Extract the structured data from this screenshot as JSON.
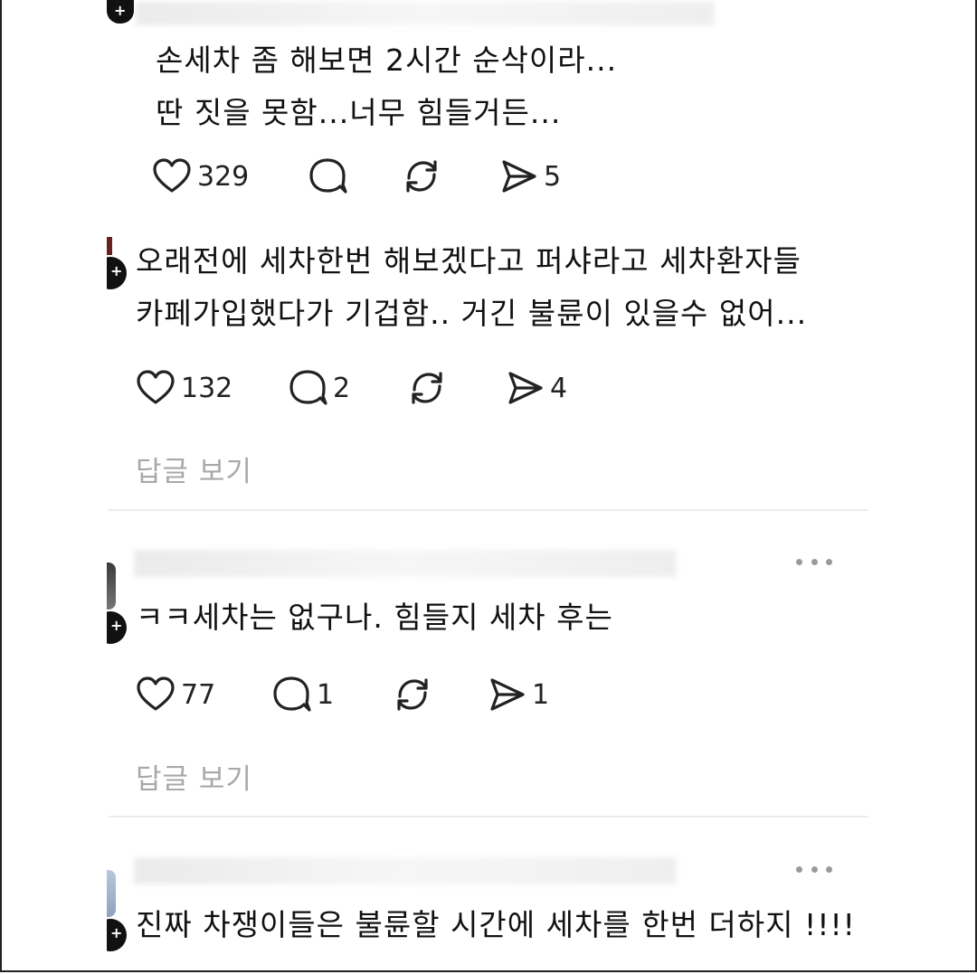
{
  "comments": [
    {
      "lines": [
        "손세차 좀 해보면 2시간 순삭이라...",
        "딴 짓을 못함...너무 힘들거든..."
      ],
      "likes": "329",
      "replies_count": "",
      "shares": "5"
    },
    {
      "lines": [
        "오래전에 세차한번 해보겠다고 퍼샤라고 세차환자들",
        "카페가입했다가 기겁함.. 거긴 불륜이 있을수 없어..."
      ],
      "likes": "132",
      "replies_count": "2",
      "shares": "4",
      "view_replies": "답글 보기"
    },
    {
      "lines": [
        "ㅋㅋ세차는 없구나. 힘들지 세차 후는"
      ],
      "likes": "77",
      "replies_count": "1",
      "shares": "1",
      "view_replies": "답글 보기"
    },
    {
      "lines": [
        "진짜 차쟁이들은 불륜할 시간에 세차를 한번 더하지 !!!!"
      ]
    }
  ],
  "icons": {
    "like": "heart-icon",
    "reply": "speech-bubble-icon",
    "repost": "repost-arrows-icon",
    "share": "send-icon",
    "more": "more-dots-icon"
  },
  "colors": {
    "text": "#111111",
    "muted": "#a8a8a8",
    "divider": "#ececec"
  }
}
